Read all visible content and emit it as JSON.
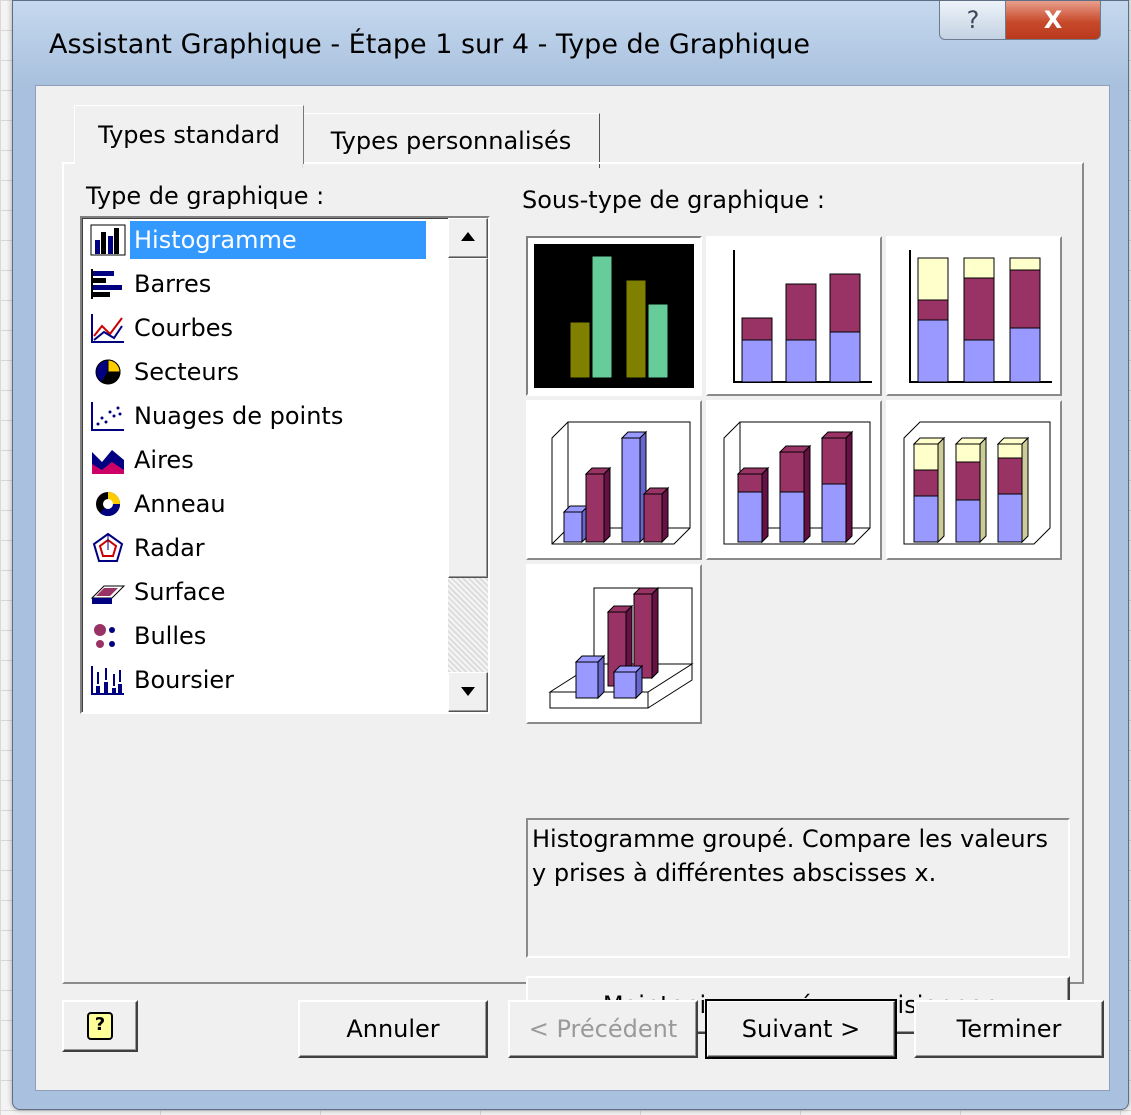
{
  "window": {
    "title": "Assistant Graphique - Étape 1 sur 4 - Type de Graphique",
    "help_glyph": "?",
    "close_glyph": "X"
  },
  "tabs": [
    {
      "label": "Types standard",
      "active": true
    },
    {
      "label": "Types personnalisés",
      "active": false
    }
  ],
  "chart_type": {
    "label": "Type de graphique :",
    "items": [
      {
        "label": "Histogramme",
        "icon": "column-chart-icon",
        "selected": true
      },
      {
        "label": "Barres",
        "icon": "bar-chart-icon"
      },
      {
        "label": "Courbes",
        "icon": "line-chart-icon"
      },
      {
        "label": "Secteurs",
        "icon": "pie-chart-icon"
      },
      {
        "label": "Nuages de points",
        "icon": "scatter-chart-icon"
      },
      {
        "label": "Aires",
        "icon": "area-chart-icon"
      },
      {
        "label": "Anneau",
        "icon": "doughnut-chart-icon"
      },
      {
        "label": "Radar",
        "icon": "radar-chart-icon"
      },
      {
        "label": "Surface",
        "icon": "surface-chart-icon"
      },
      {
        "label": "Bulles",
        "icon": "bubble-chart-icon"
      },
      {
        "label": "Boursier",
        "icon": "stock-chart-icon"
      }
    ]
  },
  "subtype": {
    "label": "Sous-type de graphique :",
    "items": [
      {
        "name": "clustered-column",
        "selected": true
      },
      {
        "name": "stacked-column"
      },
      {
        "name": "100-stacked-column"
      },
      {
        "name": "3d-clustered-column"
      },
      {
        "name": "3d-stacked-column"
      },
      {
        "name": "3d-100-stacked-column"
      },
      {
        "name": "3d-column"
      }
    ],
    "description": "Histogramme groupé. Compare les valeurs y prises à différentes abscisses x."
  },
  "buttons": {
    "preview": "Maintenir appuyé pour visionner",
    "help": "?",
    "cancel": "Annuler",
    "previous": "< Précédent",
    "next": "Suivant >",
    "finish": "Terminer"
  },
  "colors": {
    "selection": "#3399ff",
    "series_blue": "#9999ff",
    "series_maroon": "#993366",
    "series_yellow": "#ffffcc",
    "preview_olive": "#808000",
    "preview_green": "#66cc99"
  }
}
